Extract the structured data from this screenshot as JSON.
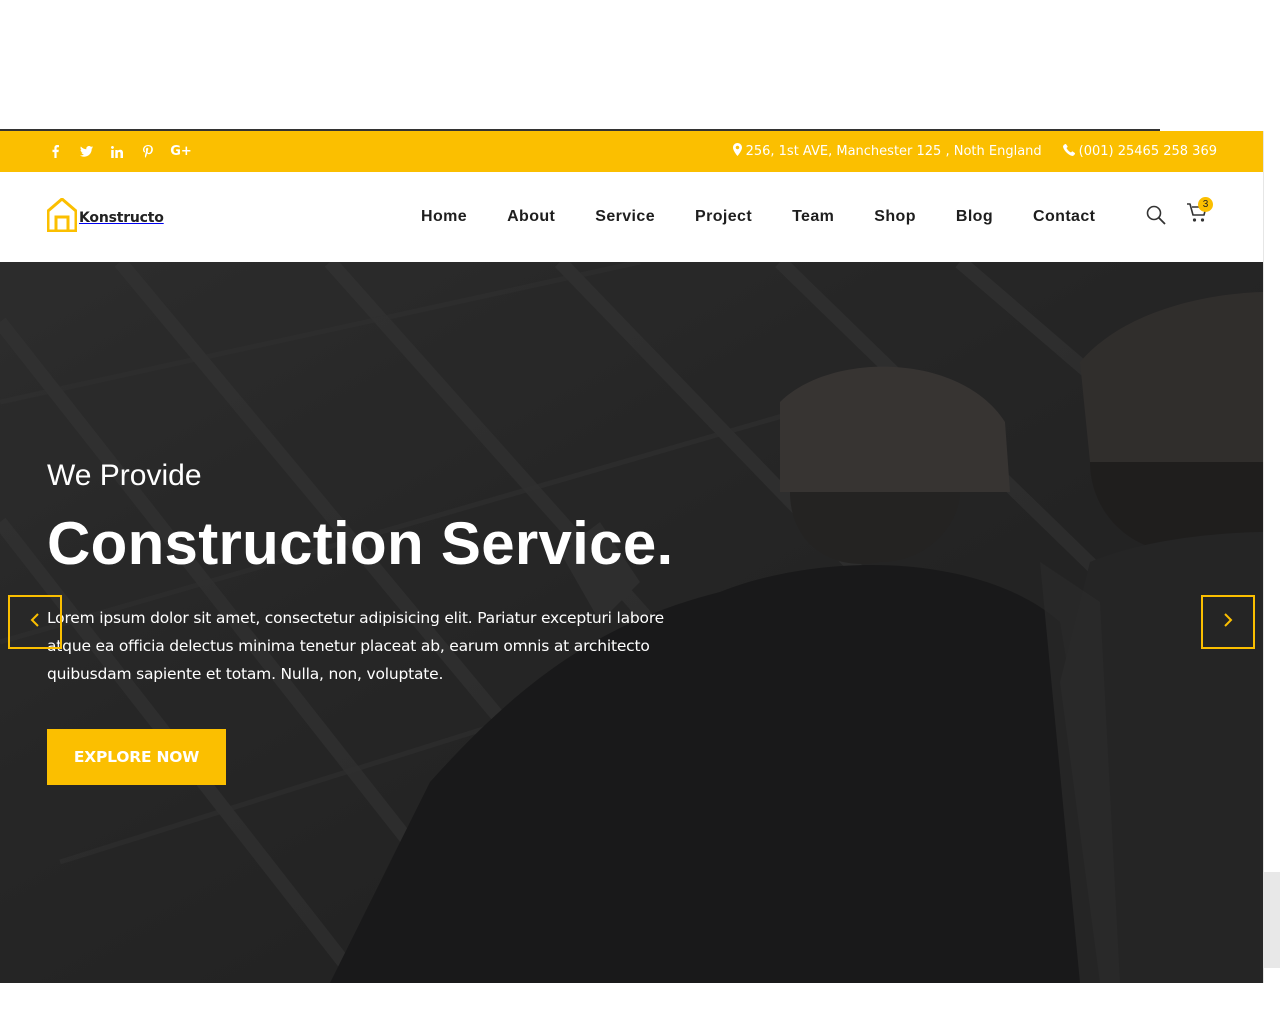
{
  "colors": {
    "accent": "#fbbf00",
    "dark_text": "#1e1e1e",
    "white": "#ffffff"
  },
  "topbar": {
    "social": [
      {
        "name": "facebook-icon"
      },
      {
        "name": "twitter-icon"
      },
      {
        "name": "linkedin-icon"
      },
      {
        "name": "pinterest-icon"
      },
      {
        "name": "google-plus-icon",
        "label": "G+"
      }
    ],
    "address": "256, 1st AVE, Manchester 125 , Noth England",
    "phone": "(001) 25465 258 369"
  },
  "header": {
    "logo_text": "Konstructo",
    "menu": [
      "Home",
      "About",
      "Service",
      "Project",
      "Team",
      "Shop",
      "Blog",
      "Contact"
    ],
    "cart_count": "3"
  },
  "hero": {
    "subtitle": "We Provide",
    "title": "Construction Service.",
    "description": "Lorem ipsum dolor sit amet, consectetur adipisicing elit. Pariatur excepturi labore atque ea officia delectus minima tenetur placeat ab, earum omnis at architecto quibusdam sapiente et totam. Nulla, non, voluptate.",
    "cta_label": "EXPLORE NOW"
  }
}
